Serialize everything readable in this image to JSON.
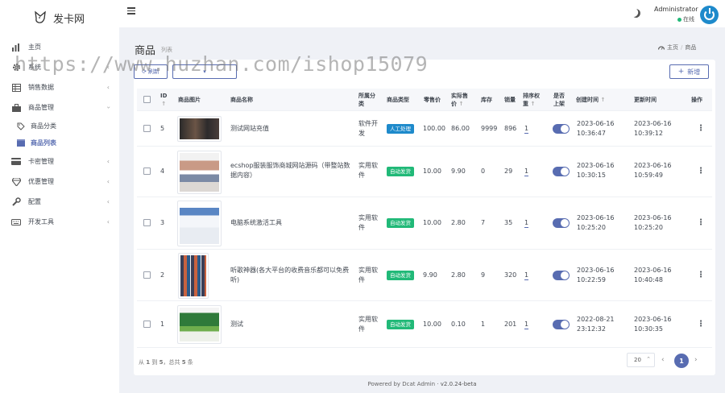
{
  "app": {
    "logo_text": "发卡网"
  },
  "sidebar": {
    "items": [
      {
        "label": "主页",
        "icon": "bar-chart-icon",
        "chevron": false
      },
      {
        "label": "系统",
        "icon": "gear-icon",
        "chevron": true
      },
      {
        "label": "销售数据",
        "icon": "table-icon",
        "chevron": true
      },
      {
        "label": "商品管理",
        "icon": "briefcase-icon",
        "chevron": true
      },
      {
        "label": "商品分类",
        "icon": "tags-icon",
        "sub": true
      },
      {
        "label": "商品列表",
        "icon": "box-icon",
        "sub": true,
        "active": true
      },
      {
        "label": "卡密管理",
        "icon": "credit-card-icon",
        "chevron": true
      },
      {
        "label": "优惠管理",
        "icon": "diamond-icon",
        "chevron": true
      },
      {
        "label": "配置",
        "icon": "wrench-icon",
        "chevron": true
      },
      {
        "label": "开发工具",
        "icon": "keyboard-icon",
        "chevron": true
      }
    ]
  },
  "header": {
    "user_name": "Administrator",
    "user_status": "在线"
  },
  "page": {
    "title": "商品",
    "subtitle": "列表",
    "breadcrumb_home": "主页",
    "breadcrumb_current": "商品"
  },
  "toolbar": {
    "refresh_label": "刷新",
    "add_label": "新增"
  },
  "watermark": "https://www.huzhan.com/ishop15079",
  "table": {
    "columns": [
      "ID",
      "商品图片",
      "商品名称",
      "所属分类",
      "商品类型",
      "零售价",
      "实际售价",
      "库存",
      "销量",
      "排序权重",
      "是否上架",
      "创建时间",
      "更新时间",
      "操作"
    ],
    "rows": [
      {
        "id": "5",
        "name": "测试网站充值",
        "category": "软件开发",
        "type": "人工处理",
        "type_color": "blue",
        "retail": "100.00",
        "price": "86.00",
        "stock": "9999",
        "sales": "896",
        "weight": "1",
        "on_shelf": true,
        "created": "2023-06-16 10:36:47",
        "updated": "2023-06-16 10:39:12"
      },
      {
        "id": "4",
        "name": "ecshop服装服饰商城网站源码（带整站数据内容）",
        "category": "实用软件",
        "type": "自动发货",
        "type_color": "green",
        "retail": "10.00",
        "price": "9.90",
        "stock": "0",
        "sales": "29",
        "weight": "1",
        "on_shelf": true,
        "created": "2023-06-16 10:30:15",
        "updated": "2023-06-16 10:59:49"
      },
      {
        "id": "3",
        "name": "电脑系统激活工具",
        "category": "实用软件",
        "type": "自动发货",
        "type_color": "green",
        "retail": "10.00",
        "price": "2.80",
        "stock": "7",
        "sales": "35",
        "weight": "1",
        "on_shelf": true,
        "created": "2023-06-16 10:25:20",
        "updated": "2023-06-16 10:25:20"
      },
      {
        "id": "2",
        "name": "听歌神器(各大平台的收费音乐都可以免费听)",
        "category": "实用软件",
        "type": "自动发货",
        "type_color": "green",
        "retail": "9.90",
        "price": "2.80",
        "stock": "9",
        "sales": "320",
        "weight": "1",
        "on_shelf": true,
        "created": "2023-06-16 10:22:59",
        "updated": "2023-06-16 10:40:48"
      },
      {
        "id": "1",
        "name": "测试",
        "category": "实用软件",
        "type": "自动发货",
        "type_color": "green",
        "retail": "10.00",
        "price": "0.10",
        "stock": "1",
        "sales": "201",
        "weight": "1",
        "on_shelf": true,
        "created": "2022-08-21 23:12:32",
        "updated": "2023-06-16 10:30:35"
      }
    ]
  },
  "pagination": {
    "summary_prefix": "从",
    "from": "1",
    "to_word": "到",
    "to": "5",
    "total_word": "，总共",
    "total": "5",
    "unit": "条",
    "per_page": "20",
    "current_page": "1"
  },
  "footer": {
    "text": "Powered by Dcat Admin",
    "version": "v2.0.24-beta"
  },
  "colors": {
    "accent": "#586cb1",
    "blue_tag": "#1e8acb",
    "green_tag": "#21b978",
    "online": "#21b978"
  }
}
